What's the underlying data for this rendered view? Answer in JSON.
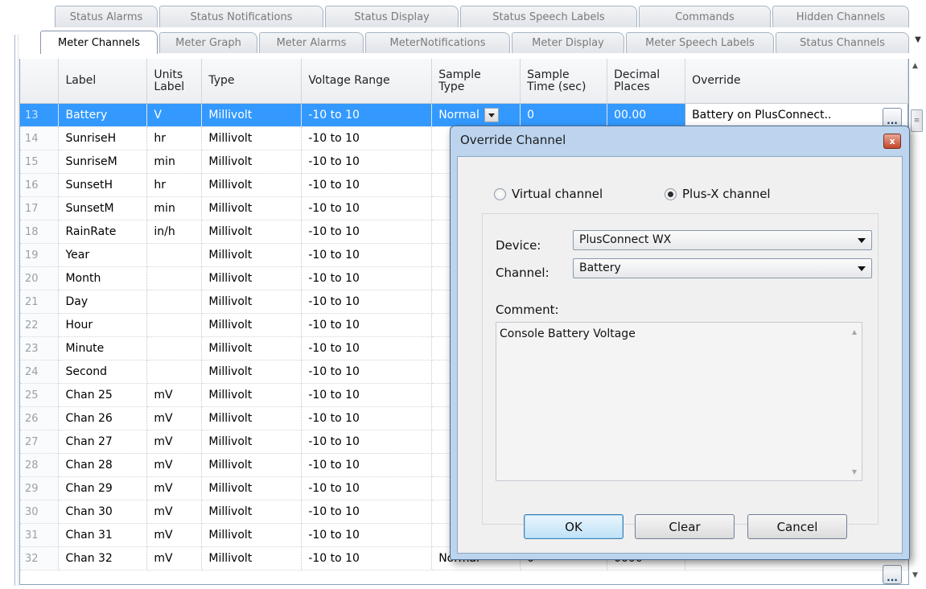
{
  "tabs_back": [
    "Status Alarms",
    "Status Notifications",
    "Status Display",
    "Status Speech Labels",
    "Commands",
    "Hidden Channels"
  ],
  "tabs_front": [
    "Meter Channels",
    "Meter Graph",
    "Meter Alarms",
    "MeterNotifications",
    "Meter Display",
    "Meter Speech Labels",
    "Status Channels"
  ],
  "active_tab": "Meter Channels",
  "columns": [
    "",
    "Label",
    "Units\nLabel",
    "Type",
    "Voltage Range",
    "Sample\nType",
    "Sample\nTime (sec)",
    "Decimal\nPlaces",
    "Override"
  ],
  "rows": [
    {
      "num": "13",
      "label": "Battery",
      "units": "V",
      "type": "Millivolt",
      "range": "-10 to 10",
      "stype": "Normal",
      "stime": "0",
      "dec": "00.00",
      "override": "Battery on PlusConnect..",
      "selected": true
    },
    {
      "num": "14",
      "label": "SunriseH",
      "units": "hr",
      "type": "Millivolt",
      "range": "-10 to 10"
    },
    {
      "num": "15",
      "label": "SunriseM",
      "units": "min",
      "type": "Millivolt",
      "range": "-10 to 10"
    },
    {
      "num": "16",
      "label": "SunsetH",
      "units": "hr",
      "type": "Millivolt",
      "range": "-10 to 10"
    },
    {
      "num": "17",
      "label": "SunsetM",
      "units": "min",
      "type": "Millivolt",
      "range": "-10 to 10"
    },
    {
      "num": "18",
      "label": "RainRate",
      "units": "in/h",
      "type": "Millivolt",
      "range": "-10 to 10"
    },
    {
      "num": "19",
      "label": "Year",
      "units": "",
      "type": "Millivolt",
      "range": "-10 to 10"
    },
    {
      "num": "20",
      "label": "Month",
      "units": "",
      "type": "Millivolt",
      "range": "-10 to 10"
    },
    {
      "num": "21",
      "label": "Day",
      "units": "",
      "type": "Millivolt",
      "range": "-10 to 10"
    },
    {
      "num": "22",
      "label": "Hour",
      "units": "",
      "type": "Millivolt",
      "range": "-10 to 10"
    },
    {
      "num": "23",
      "label": "Minute",
      "units": "",
      "type": "Millivolt",
      "range": "-10 to 10"
    },
    {
      "num": "24",
      "label": "Second",
      "units": "",
      "type": "Millivolt",
      "range": "-10 to 10"
    },
    {
      "num": "25",
      "label": "Chan 25",
      "units": "mV",
      "type": "Millivolt",
      "range": "-10 to 10"
    },
    {
      "num": "26",
      "label": "Chan 26",
      "units": "mV",
      "type": "Millivolt",
      "range": "-10 to 10"
    },
    {
      "num": "27",
      "label": "Chan 27",
      "units": "mV",
      "type": "Millivolt",
      "range": "-10 to 10"
    },
    {
      "num": "28",
      "label": "Chan 28",
      "units": "mV",
      "type": "Millivolt",
      "range": "-10 to 10"
    },
    {
      "num": "29",
      "label": "Chan 29",
      "units": "mV",
      "type": "Millivolt",
      "range": "-10 to 10"
    },
    {
      "num": "30",
      "label": "Chan 30",
      "units": "mV",
      "type": "Millivolt",
      "range": "-10 to 10"
    },
    {
      "num": "31",
      "label": "Chan 31",
      "units": "mV",
      "type": "Millivolt",
      "range": "-10 to 10"
    },
    {
      "num": "32",
      "label": "Chan 32",
      "units": "mV",
      "type": "Millivolt",
      "range": "-10 to 10",
      "stype": "Normal",
      "stime": "0",
      "dec": "0000"
    }
  ],
  "dialog": {
    "title": "Override Channel",
    "radio_virtual": "Virtual channel",
    "radio_plusx": "Plus-X channel",
    "selected_radio": "Plus-X channel",
    "device_label": "Device:",
    "device_value": "PlusConnect WX",
    "channel_label": "Channel:",
    "channel_value": "Battery",
    "comment_label": "Comment:",
    "comment_value": "Console Battery Voltage",
    "ok": "OK",
    "clear": "Clear",
    "cancel": "Cancel",
    "close_glyph": "x"
  },
  "ellipsis": "...",
  "colors": {
    "selection": "#3399ff",
    "dialog_frame": "#bcd4ee"
  }
}
